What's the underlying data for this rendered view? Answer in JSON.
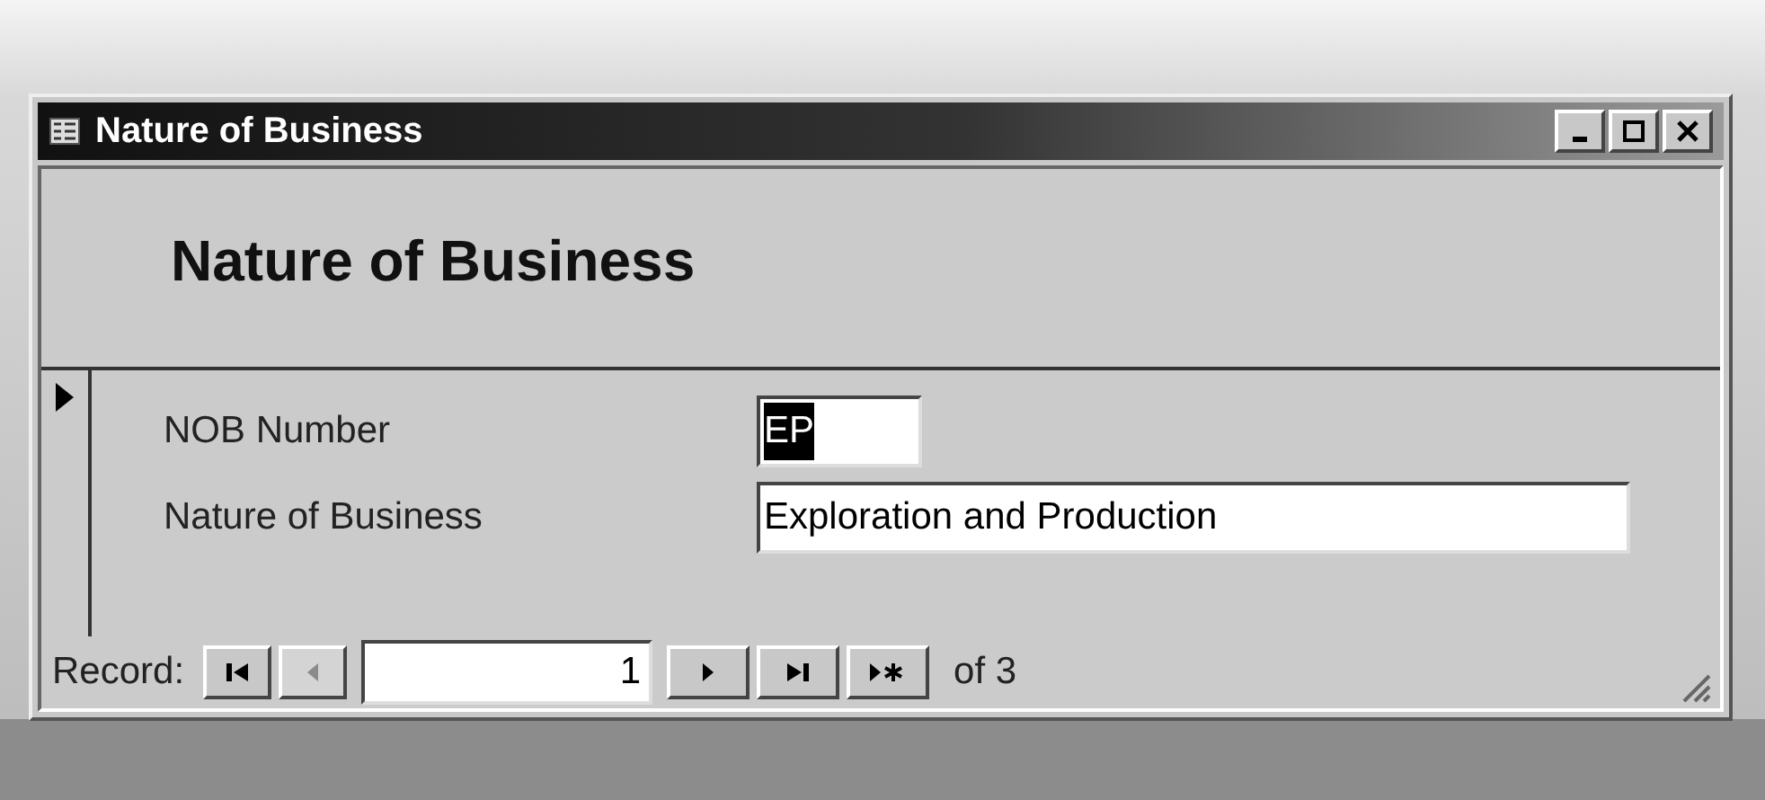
{
  "window": {
    "title": "Nature of Business"
  },
  "form": {
    "heading": "Nature of Business",
    "record_selector": {
      "current": true
    },
    "fields": [
      {
        "label": "NOB Number",
        "value": "EP",
        "selected_text": true,
        "kind": "code"
      },
      {
        "label": "Nature of Business",
        "value": "Exploration and Production",
        "selected_text": false,
        "kind": "text"
      }
    ]
  },
  "navigation": {
    "label": "Record:",
    "record_number": "1",
    "total": "of 3",
    "buttons": [
      {
        "kind": "first",
        "disabled": false
      },
      {
        "kind": "previous",
        "disabled": true
      },
      {
        "kind": "next",
        "disabled": false
      },
      {
        "kind": "last",
        "disabled": false
      },
      {
        "kind": "new",
        "disabled": false
      }
    ]
  }
}
